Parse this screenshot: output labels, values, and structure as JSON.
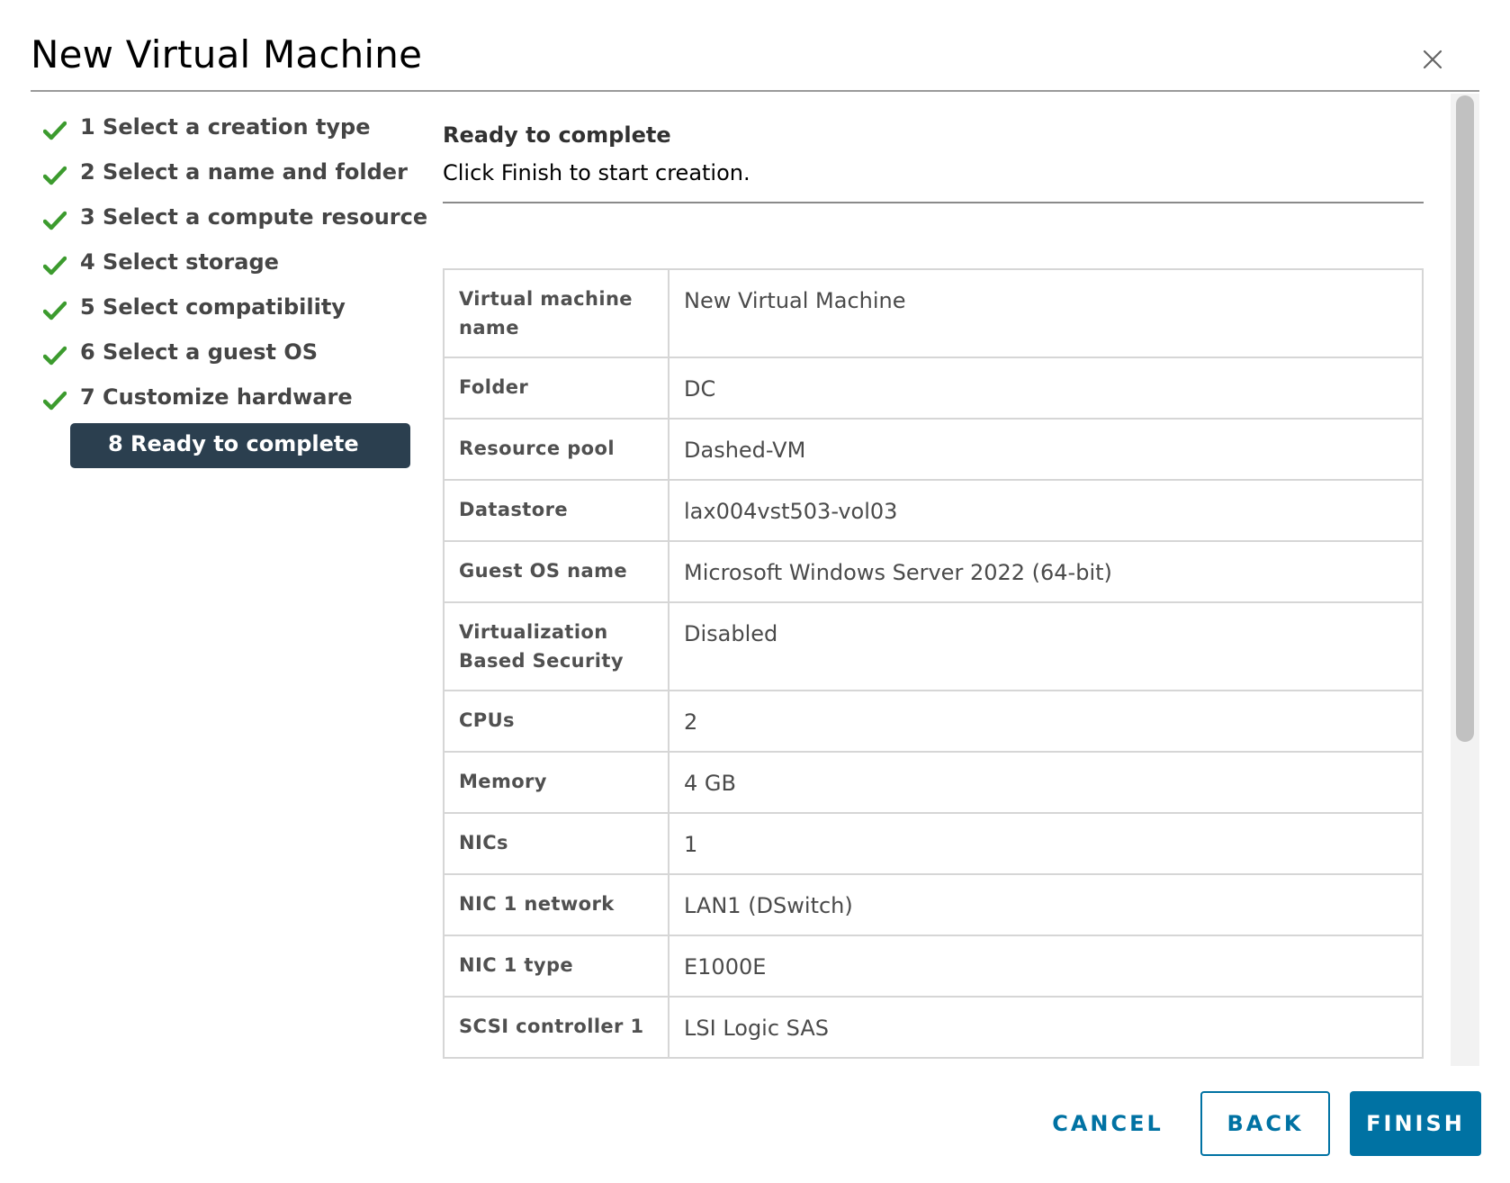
{
  "window": {
    "title": "New Virtual Machine"
  },
  "steps": [
    {
      "label": "1 Select a creation type",
      "done": true
    },
    {
      "label": "2 Select a name and folder",
      "done": true
    },
    {
      "label": "3 Select a compute resource",
      "done": true
    },
    {
      "label": "4 Select storage",
      "done": true
    },
    {
      "label": "5 Select compatibility",
      "done": true
    },
    {
      "label": "6 Select a guest OS",
      "done": true
    },
    {
      "label": "7 Customize hardware",
      "done": true
    },
    {
      "label": "8 Ready to complete",
      "done": false,
      "active": true
    }
  ],
  "content": {
    "heading": "Ready to complete",
    "subheading": "Click Finish to start creation."
  },
  "summary": [
    {
      "key": "Virtual machine name",
      "value": "New Virtual Machine"
    },
    {
      "key": "Folder",
      "value": "DC"
    },
    {
      "key": "Resource pool",
      "value": "Dashed-VM"
    },
    {
      "key": "Datastore",
      "value": "lax004vst503-vol03"
    },
    {
      "key": "Guest OS name",
      "value": "Microsoft Windows Server 2022 (64-bit)"
    },
    {
      "key": "Virtualization Based Security",
      "value": "Disabled"
    },
    {
      "key": "CPUs",
      "value": "2"
    },
    {
      "key": "Memory",
      "value": "4 GB"
    },
    {
      "key": "NICs",
      "value": "1"
    },
    {
      "key": "NIC 1 network",
      "value": "LAN1 (DSwitch)"
    },
    {
      "key": "NIC 1 type",
      "value": "E1000E"
    },
    {
      "key": "SCSI controller 1",
      "value": "LSI Logic SAS"
    }
  ],
  "footer": {
    "cancel_label": "CANCEL",
    "back_label": "BACK",
    "finish_label": "FINISH"
  },
  "colors": {
    "check": "#3c9b2e",
    "active_step_bg": "#2b3f4f",
    "primary": "#0072a3"
  },
  "icons": {
    "close": "close-icon",
    "check": "check-icon"
  }
}
